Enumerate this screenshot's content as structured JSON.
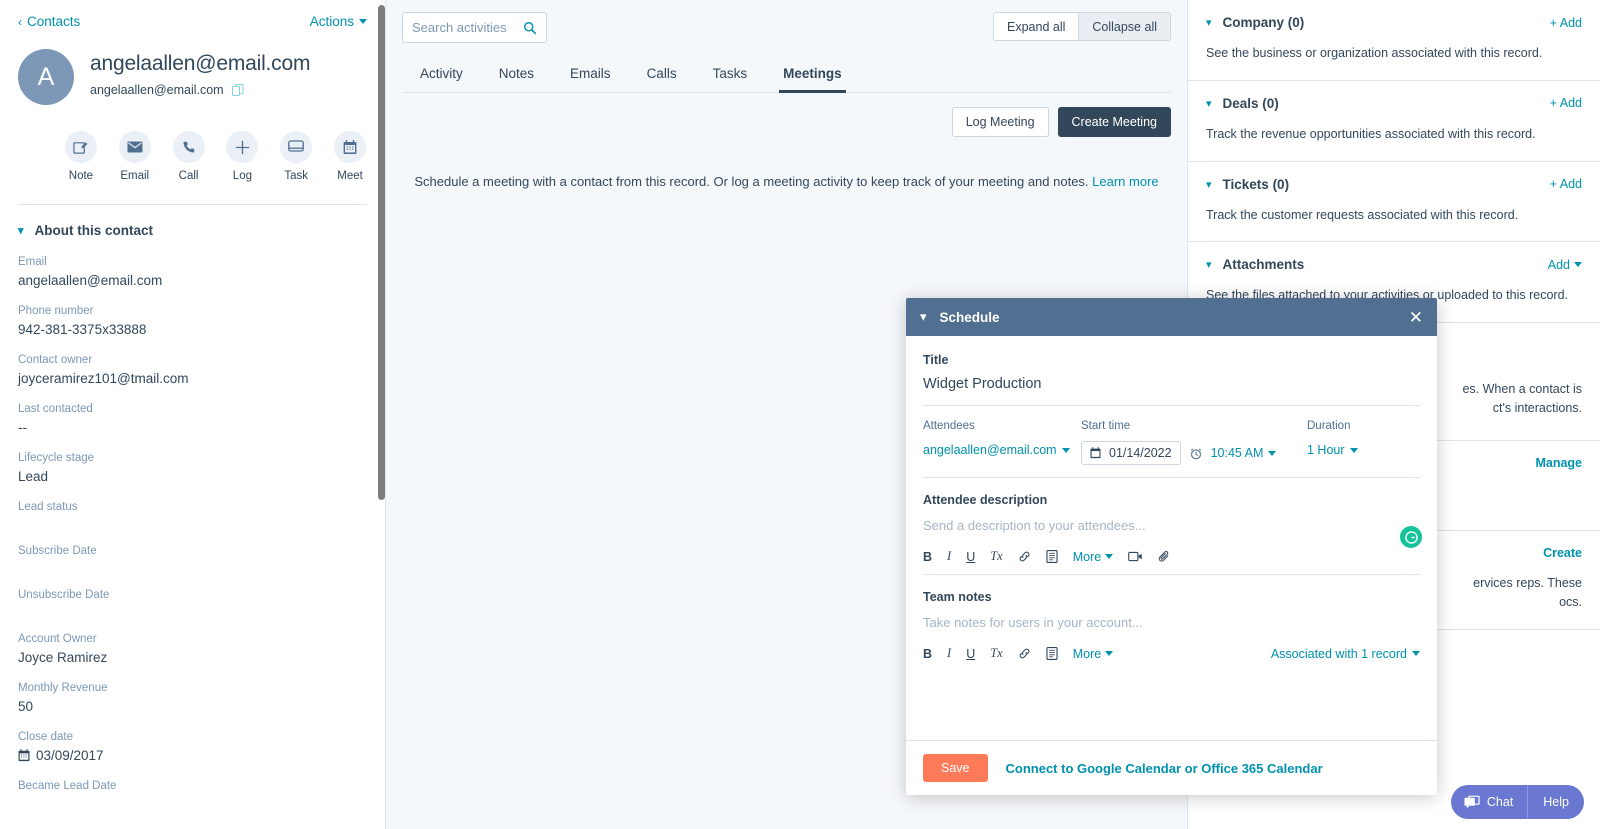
{
  "left": {
    "breadcrumb": "Contacts",
    "actions_label": "Actions",
    "avatar_initial": "A",
    "contact_title": "angelaallen@email.com",
    "contact_subtitle": "angelaallen@email.com",
    "copy_icon": "copy-icon",
    "quick_actions": [
      {
        "label": "Note",
        "icon": "note-icon"
      },
      {
        "label": "Email",
        "icon": "email-icon"
      },
      {
        "label": "Call",
        "icon": "call-icon"
      },
      {
        "label": "Log",
        "icon": "plus-icon"
      },
      {
        "label": "Task",
        "icon": "task-icon"
      },
      {
        "label": "Meet",
        "icon": "calendar-icon"
      }
    ],
    "about_title": "About this contact",
    "fields": [
      {
        "label": "Email",
        "value": "angelaallen@email.com",
        "date": false
      },
      {
        "label": "Phone number",
        "value": "942-381-3375x33888",
        "date": false
      },
      {
        "label": "Contact owner",
        "value": "joyceramirez101@tmail.com",
        "date": false
      },
      {
        "label": "Last contacted",
        "value": "--",
        "date": false
      },
      {
        "label": "Lifecycle stage",
        "value": "Lead",
        "date": false
      },
      {
        "label": "Lead status",
        "value": "",
        "date": false
      },
      {
        "label": "Subscribe Date",
        "value": "",
        "date": false
      },
      {
        "label": "Unsubscribe Date",
        "value": "",
        "date": false
      },
      {
        "label": "Account Owner",
        "value": "Joyce Ramirez",
        "date": false
      },
      {
        "label": "Monthly Revenue",
        "value": "50",
        "date": false
      },
      {
        "label": "Close date",
        "value": "03/09/2017",
        "date": true
      },
      {
        "label": "Became Lead Date",
        "value": "",
        "date": false
      }
    ]
  },
  "center": {
    "search_placeholder": "Search activities",
    "search_value": "",
    "expand_all": "Expand all",
    "collapse_all": "Collapse all",
    "tabs": [
      {
        "label": "Activity",
        "active": false
      },
      {
        "label": "Notes",
        "active": false
      },
      {
        "label": "Emails",
        "active": false
      },
      {
        "label": "Calls",
        "active": false
      },
      {
        "label": "Tasks",
        "active": false
      },
      {
        "label": "Meetings",
        "active": true
      }
    ],
    "log_meeting": "Log Meeting",
    "create_meeting": "Create Meeting",
    "empty_text": "Schedule a meeting with a contact from this record. Or log a meeting activity to keep track of your meeting and notes.",
    "empty_link": "Learn more"
  },
  "right": {
    "cards": [
      {
        "title": "Company (0)",
        "action": "+ Add",
        "body": "See the business or organization associated with this record."
      },
      {
        "title": "Deals (0)",
        "action": "+ Add",
        "body": "Track the revenue opportunities associated with this record."
      },
      {
        "title": "Tickets (0)",
        "action": "+ Add",
        "body": "Track the customer requests associated with this record."
      },
      {
        "title": "Attachments",
        "action": "Add",
        "body": "See the files attached to your activities or uploaded to this record."
      },
      {
        "title": "",
        "action": "",
        "body": "es. When a contact is\nct's interactions."
      },
      {
        "title": "",
        "action": "Manage",
        "body": ""
      },
      {
        "title": "",
        "action": "Create",
        "body": "ervices reps. These\nocs."
      }
    ]
  },
  "modal": {
    "header_title": "Schedule",
    "collapse_icon": "chevron-down-icon",
    "close_icon": "close-icon",
    "title_label": "Title",
    "title_value": "Widget Production",
    "attendees_label": "Attendees",
    "attendees_value": "angelaallen@email.com",
    "start_time_label": "Start time",
    "start_date_value": "01/14/2022",
    "start_time_value": "10:45 AM",
    "duration_label": "Duration",
    "duration_value": "1 Hour",
    "attendee_desc_label": "Attendee description",
    "attendee_desc_placeholder": "Send a description to your attendees...",
    "team_notes_label": "Team notes",
    "team_notes_placeholder": "Take notes for users in your account...",
    "toolbar": {
      "bold": "B",
      "italic": "I",
      "underline": "U",
      "clear_format": "Tx",
      "link": "link-icon",
      "snippet": "snippet-icon",
      "more": "More",
      "video": "video-icon",
      "attach": "attachment-icon"
    },
    "associated_label": "Associated with 1 record",
    "save_label": "Save",
    "calendar_link": "Connect to Google Calendar or Office 365 Calendar",
    "grammarly_icon": "grammarly-icon"
  },
  "chat": {
    "chat_label": "Chat",
    "help_label": "Help",
    "chat_icon": "chat-bubble-icon"
  },
  "colors": {
    "accent_teal": "#0091ae",
    "navy": "#33475b",
    "orange": "#ff7a59",
    "modal_header": "#516f90",
    "chat_purple": "#6a78d1",
    "grammarly_green": "#15c39a"
  }
}
